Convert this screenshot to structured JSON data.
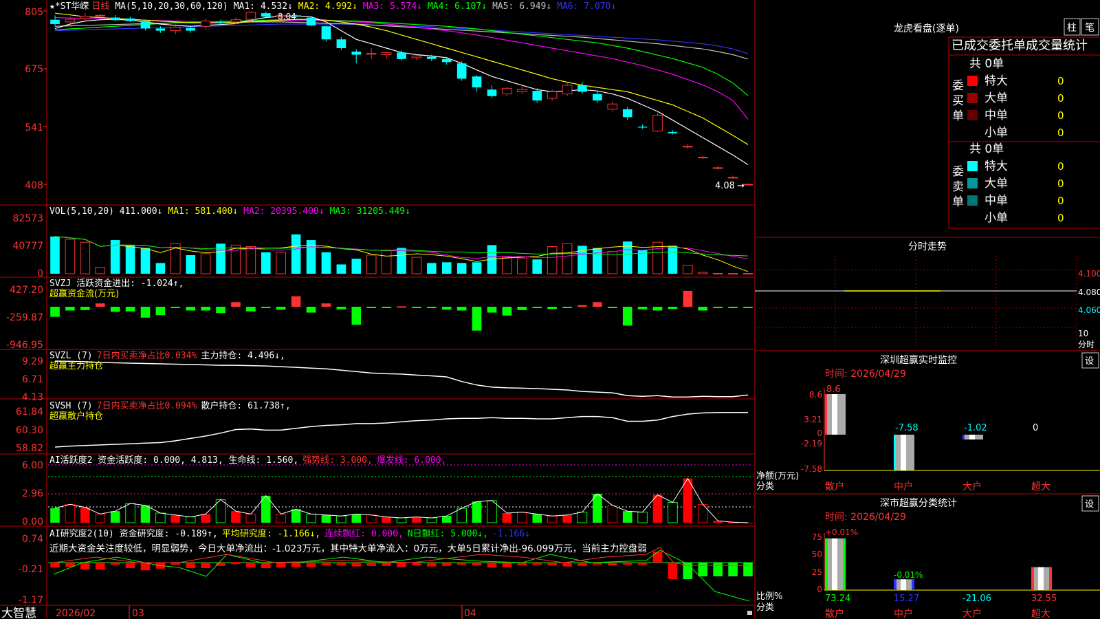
{
  "stock": {
    "name": "★*ST华嵘",
    "period": "日线",
    "ma_header": {
      "label": "MA(5,10,20,30,60,120)",
      "items": [
        {
          "text": "MA1: 4.532↓",
          "color": "#ffffff"
        },
        {
          "text": "MA2: 4.992↓",
          "color": "#ffff00"
        },
        {
          "text": "MA3: 5.574↓",
          "color": "#ff00ff"
        },
        {
          "text": "MA4: 6.107↓",
          "color": "#00ff00"
        },
        {
          "text": "MA5: 6.949↓",
          "color": "#c0c0c0"
        },
        {
          "text": "MA6: 7.070↓",
          "color": "#3333ff"
        }
      ]
    },
    "price_axis": [
      "805",
      "675",
      "541",
      "408"
    ],
    "high_label": "8.04",
    "last_label": "4.08"
  },
  "vol_panel": {
    "header": "VOL(5,10,20) 411.000↓",
    "items": [
      {
        "text": "MA1: 581.400↓",
        "color": "#ffff00"
      },
      {
        "text": "MA2: 20395.400↓",
        "color": "#ff00ff"
      },
      {
        "text": "MA3: 31205.449↓",
        "color": "#00ff00"
      }
    ],
    "axis": [
      "82573",
      "40777",
      "0"
    ]
  },
  "svzj_panel": {
    "header": "SVZJ  活跃资金进出: -1.024↑,",
    "subtitle": "超赢资金流(万元)",
    "axis": [
      "427.20",
      "-259.87",
      "-946.95"
    ]
  },
  "svzl_panel": {
    "title": "SVZL (7)",
    "red_text": "7日内买卖净占比0.034%",
    "tail": "主力持仓: 4.496↓,",
    "subtitle": "超赢主力持仓",
    "axis": [
      "9.29",
      "6.71",
      "4.13"
    ]
  },
  "svsh_panel": {
    "title": "SVSH (7)",
    "red_text": "7日内买卖净占比0.094%",
    "tail": "散户持仓: 61.738↑,",
    "subtitle": "超赢散户持仓",
    "axis": [
      "61.84",
      "60.30",
      "58.82"
    ]
  },
  "ai_active_panel": {
    "header": "AI活跃度2 资金活跃度: 0.000, 4.813, 生命线: 1.560,",
    "strong": "强势线: 3.000,",
    "burst": "爆发线: 6.000,",
    "axis": [
      "6.00",
      "2.96",
      "0.00"
    ]
  },
  "ai_research_panel": {
    "header": "AI研究度2(10) 资金研究度: -0.189↑,",
    "avg": "平均研究度: -1.166↓,",
    "lianxu": "连续飘红: 0.000,",
    "nday": "N日飘红: 5.000↓,",
    "last": "-1.166↓",
    "comment": "近期大资金关注度较低，明显弱势，今日大单净流出：-1.023万元，其中特大单净流入：0万元，大单5日累计净出-96.099万元，当前主力控盘弱",
    "axis": [
      "0.74",
      "-0.21",
      "-1.17"
    ]
  },
  "date_axis": {
    "logo": "大智慧",
    "labels": [
      "2026/02",
      "03",
      "04"
    ]
  },
  "dragon_tiger": {
    "title": "龙虎看盘(逐单)",
    "btn_bar": "柱",
    "btn_pen": "笔",
    "tabs": "已成交委托单成交量统计",
    "buy": {
      "side": "委买单",
      "total": "共 0单",
      "rows": [
        {
          "label": "特大",
          "value": "0",
          "color": "#ff0000"
        },
        {
          "label": "大单",
          "value": "0",
          "color": "#990000"
        },
        {
          "label": "中单",
          "value": "0",
          "color": "#660000"
        },
        {
          "label": "小单",
          "value": "0",
          "color": ""
        }
      ]
    },
    "sell": {
      "side": "委卖单",
      "total": "共 0单",
      "rows": [
        {
          "label": "特大",
          "value": "0",
          "color": "#00ffff"
        },
        {
          "label": "大单",
          "value": "0",
          "color": "#009999"
        },
        {
          "label": "中单",
          "value": "0",
          "color": "#007777"
        },
        {
          "label": "小单",
          "value": "0",
          "color": ""
        }
      ]
    }
  },
  "intraday": {
    "title": "分时走势",
    "axis": [
      "4.100",
      "4.080",
      "4.060"
    ],
    "unit_top": "10",
    "unit_bottom": "分时"
  },
  "sz_monitor": {
    "title": "深圳超赢实时监控",
    "settings": "设",
    "time": "时间: 2026/04/29",
    "axis": [
      "8.6",
      "3.21",
      "0",
      "-2.19",
      "-7.58"
    ],
    "ylabel": "净额(万元)",
    "xlabel": "分类",
    "categories": [
      "散户",
      "中户",
      "大户",
      "超大"
    ],
    "values": [
      8.6,
      -7.58,
      -1.02,
      0
    ],
    "value_labels": [
      "8.6",
      "-7.58",
      "-1.02",
      "0"
    ]
  },
  "sz_class": {
    "title": "深市超赢分类统计",
    "settings": "设",
    "time": "时间: 2026/04/29",
    "axis": [
      "75",
      "50",
      "25",
      "0"
    ],
    "ylabel": "比例%",
    "xlabel": "分类",
    "categories": [
      "散户",
      "中户",
      "大户",
      "超大"
    ],
    "values": [
      73.24,
      15.27,
      -21.06,
      32.55
    ],
    "value_labels": [
      "73.24",
      "15.27",
      "-21.06",
      "32.55"
    ],
    "change_labels": [
      "+0.01%",
      "-0.01%",
      "",
      ""
    ]
  },
  "chart_data": {
    "type": "candlestick",
    "title": "★*ST华嵘 日线",
    "x_labels": [
      "2026/02",
      "03",
      "04"
    ],
    "ohlc": [
      [
        7.85,
        7.95,
        7.7,
        7.75
      ],
      [
        7.8,
        7.92,
        7.72,
        7.86
      ],
      [
        7.88,
        8.0,
        7.8,
        7.93
      ],
      [
        7.95,
        7.98,
        7.9,
        7.95
      ],
      [
        7.9,
        7.96,
        7.82,
        7.84
      ],
      [
        7.88,
        7.92,
        7.8,
        7.82
      ],
      [
        7.82,
        7.85,
        7.6,
        7.65
      ],
      [
        7.65,
        7.7,
        7.55,
        7.6
      ],
      [
        7.6,
        7.75,
        7.52,
        7.68
      ],
      [
        7.66,
        7.7,
        7.55,
        7.6
      ],
      [
        7.7,
        7.88,
        7.62,
        7.82
      ],
      [
        7.8,
        7.85,
        7.72,
        7.78
      ],
      [
        7.8,
        7.9,
        7.75,
        7.85
      ],
      [
        7.86,
        8.04,
        7.82,
        8.02
      ],
      [
        8.0,
        8.04,
        7.9,
        7.92
      ],
      [
        7.92,
        7.98,
        7.85,
        7.95
      ],
      [
        7.95,
        7.98,
        7.9,
        7.92
      ],
      [
        7.9,
        7.92,
        7.7,
        7.72
      ],
      [
        7.7,
        7.72,
        7.35,
        7.4
      ],
      [
        7.4,
        7.45,
        7.15,
        7.2
      ],
      [
        7.12,
        7.18,
        6.85,
        7.05
      ],
      [
        7.06,
        7.2,
        6.95,
        7.08
      ],
      [
        7.05,
        7.12,
        6.95,
        7.1
      ],
      [
        7.1,
        7.15,
        6.92,
        6.95
      ],
      [
        6.98,
        7.05,
        6.92,
        7.02
      ],
      [
        7.0,
        7.05,
        6.9,
        6.95
      ],
      [
        6.95,
        6.98,
        6.82,
        6.88
      ],
      [
        6.85,
        6.9,
        6.45,
        6.5
      ],
      [
        6.55,
        6.58,
        6.2,
        6.3
      ],
      [
        6.25,
        6.35,
        6.05,
        6.1
      ],
      [
        6.15,
        6.3,
        6.1,
        6.28
      ],
      [
        6.2,
        6.35,
        6.15,
        6.25
      ],
      [
        6.22,
        6.28,
        5.95,
        6.0
      ],
      [
        6.05,
        6.25,
        6.0,
        6.2
      ],
      [
        6.15,
        6.4,
        6.1,
        6.35
      ],
      [
        6.35,
        6.42,
        6.15,
        6.2
      ],
      [
        6.15,
        6.22,
        5.95,
        6.0
      ],
      [
        5.8,
        5.98,
        5.75,
        5.92
      ],
      [
        5.8,
        5.85,
        5.55,
        5.62
      ],
      [
        5.4,
        5.45,
        5.35,
        5.38
      ],
      [
        5.3,
        5.72,
        5.28,
        5.66
      ],
      [
        5.28,
        5.32,
        5.22,
        5.25
      ],
      [
        4.95,
        5.0,
        4.9,
        4.95
      ],
      [
        4.7,
        4.74,
        4.66,
        4.7
      ],
      [
        4.46,
        4.5,
        4.42,
        4.46
      ],
      [
        4.24,
        4.28,
        4.2,
        4.24
      ],
      [
        4.08,
        4.1,
        4.06,
        4.08
      ]
    ],
    "ma": {
      "MA1": [
        7.65,
        7.75,
        7.82,
        7.85,
        7.86,
        7.84,
        7.8,
        7.75,
        7.72,
        7.7,
        7.72,
        7.74,
        7.76,
        7.84,
        7.9,
        7.93,
        7.94,
        7.92,
        7.8,
        7.6,
        7.4,
        7.3,
        7.2,
        7.1,
        7.05,
        7.02,
        6.98,
        6.85,
        6.7,
        6.55,
        6.45,
        6.35,
        6.25,
        6.2,
        6.22,
        6.25,
        6.22,
        6.15,
        6.05,
        5.9,
        5.75,
        5.55,
        5.35,
        5.15,
        4.95,
        4.75,
        4.53
      ],
      "MA2": [
        8.0,
        7.96,
        7.92,
        7.9,
        7.88,
        7.86,
        7.84,
        7.82,
        7.8,
        7.78,
        7.78,
        7.78,
        7.79,
        7.8,
        7.82,
        7.84,
        7.86,
        7.86,
        7.84,
        7.8,
        7.75,
        7.68,
        7.6,
        7.5,
        7.4,
        7.3,
        7.2,
        7.1,
        7.0,
        6.9,
        6.8,
        6.7,
        6.6,
        6.5,
        6.42,
        6.35,
        6.3,
        6.25,
        6.2,
        6.1,
        6.0,
        5.9,
        5.75,
        5.6,
        5.4,
        5.2,
        4.99
      ],
      "MA3": [
        7.9,
        7.89,
        7.88,
        7.87,
        7.86,
        7.85,
        7.84,
        7.83,
        7.82,
        7.81,
        7.8,
        7.8,
        7.8,
        7.81,
        7.82,
        7.83,
        7.84,
        7.84,
        7.83,
        7.82,
        7.8,
        7.78,
        7.75,
        7.72,
        7.68,
        7.64,
        7.6,
        7.55,
        7.5,
        7.44,
        7.38,
        7.32,
        7.26,
        7.2,
        7.14,
        7.08,
        7.02,
        6.96,
        6.88,
        6.8,
        6.7,
        6.6,
        6.48,
        6.36,
        6.2,
        6.0,
        5.57
      ],
      "MA4": [
        7.62,
        7.64,
        7.66,
        7.68,
        7.7,
        7.72,
        7.74,
        7.76,
        7.78,
        7.79,
        7.8,
        7.81,
        7.82,
        7.83,
        7.84,
        7.85,
        7.85,
        7.85,
        7.84,
        7.83,
        7.82,
        7.8,
        7.78,
        7.76,
        7.74,
        7.72,
        7.7,
        7.67,
        7.64,
        7.6,
        7.56,
        7.52,
        7.48,
        7.44,
        7.4,
        7.36,
        7.32,
        7.26,
        7.2,
        7.12,
        7.04,
        6.96,
        6.86,
        6.76,
        6.6,
        6.4,
        6.11
      ],
      "MA5": [
        7.7,
        7.71,
        7.72,
        7.73,
        7.74,
        7.75,
        7.76,
        7.77,
        7.78,
        7.79,
        7.8,
        7.8,
        7.8,
        7.8,
        7.8,
        7.8,
        7.79,
        7.78,
        7.77,
        7.76,
        7.75,
        7.73,
        7.71,
        7.69,
        7.67,
        7.65,
        7.63,
        7.61,
        7.59,
        7.57,
        7.55,
        7.53,
        7.51,
        7.49,
        7.47,
        7.45,
        7.42,
        7.39,
        7.36,
        7.33,
        7.3,
        7.26,
        7.22,
        7.18,
        7.12,
        7.05,
        6.95
      ],
      "MA6": [
        7.6,
        7.61,
        7.62,
        7.63,
        7.64,
        7.65,
        7.66,
        7.67,
        7.68,
        7.69,
        7.7,
        7.71,
        7.72,
        7.73,
        7.74,
        7.75,
        7.75,
        7.75,
        7.75,
        7.75,
        7.74,
        7.73,
        7.72,
        7.71,
        7.7,
        7.69,
        7.67,
        7.65,
        7.63,
        7.61,
        7.59,
        7.57,
        7.55,
        7.53,
        7.51,
        7.49,
        7.47,
        7.45,
        7.43,
        7.41,
        7.39,
        7.36,
        7.33,
        7.3,
        7.25,
        7.18,
        7.07
      ]
    },
    "volume": [
      52000,
      48000,
      44000,
      9000,
      47000,
      40000,
      36000,
      15000,
      42000,
      26000,
      28000,
      42000,
      40000,
      38000,
      30000,
      30000,
      55000,
      47000,
      30000,
      13000,
      21000,
      26000,
      33000,
      36000,
      23000,
      15000,
      16000,
      15000,
      16000,
      40000,
      23000,
      22000,
      20000,
      38000,
      42000,
      39000,
      36000,
      31000,
      45000,
      33000,
      44000,
      39000,
      12000,
      2000,
      500,
      400,
      411
    ],
    "fund_flow": [
      -240,
      -90,
      -80,
      80,
      -120,
      -110,
      -260,
      -200,
      -20,
      -90,
      -90,
      -150,
      110,
      -110,
      -30,
      -70,
      250,
      -140,
      80,
      -60,
      -430,
      -20,
      -25,
      10,
      -30,
      -20,
      -70,
      -90,
      -570,
      -140,
      -210,
      -80,
      -30,
      -50,
      -30,
      40,
      110,
      -30,
      -450,
      -60,
      -90,
      -50,
      380,
      -90,
      -20,
      -20,
      -10
    ],
    "main_hold": [
      9.29,
      9.25,
      9.2,
      9.1,
      9.05,
      9.0,
      8.95,
      8.9,
      8.85,
      8.8,
      8.75,
      8.7,
      8.7,
      8.65,
      8.6,
      8.5,
      8.4,
      8.3,
      8.2,
      8.0,
      7.8,
      7.6,
      7.5,
      7.45,
      7.3,
      7.2,
      7.05,
      6.4,
      5.9,
      5.6,
      5.5,
      5.45,
      5.4,
      5.3,
      5.2,
      5.0,
      4.9,
      4.8,
      4.4,
      4.3,
      4.4,
      4.2,
      4.2,
      4.3,
      4.25,
      4.25,
      4.5
    ],
    "retail_hold": [
      58.82,
      58.9,
      58.95,
      59.0,
      59.05,
      59.1,
      59.15,
      59.2,
      59.35,
      59.55,
      59.75,
      60.0,
      60.3,
      60.35,
      60.25,
      60.25,
      60.4,
      60.55,
      60.65,
      60.7,
      60.8,
      60.8,
      60.85,
      60.95,
      61.05,
      61.1,
      61.2,
      61.25,
      61.25,
      61.3,
      61.25,
      61.25,
      61.2,
      61.2,
      61.3,
      61.4,
      61.4,
      61.3,
      61.0,
      61.0,
      61.1,
      61.4,
      61.6,
      61.7,
      61.74,
      61.74,
      61.74
    ],
    "activity": [
      1.5,
      1.9,
      1.6,
      0.9,
      1.2,
      2.0,
      1.8,
      1.0,
      0.8,
      0.6,
      0.9,
      2.4,
      1.2,
      0.9,
      2.8,
      0.9,
      1.4,
      0.9,
      0.8,
      0.7,
      0.9,
      0.8,
      0.6,
      0.5,
      0.6,
      0.5,
      0.7,
      1.5,
      2.2,
      2.3,
      1.0,
      1.1,
      0.9,
      0.7,
      0.8,
      1.1,
      3.0,
      1.8,
      1.2,
      1.1,
      2.9,
      2.1,
      4.6,
      1.9,
      0.2,
      0.05,
      0.0
    ],
    "research": [
      -0.18,
      -0.15,
      -0.25,
      -0.25,
      -0.08,
      -0.2,
      -0.28,
      -0.22,
      -0.05,
      -0.2,
      -0.2,
      -0.12,
      0.02,
      -0.18,
      -0.2,
      -0.18,
      -0.16,
      -0.16,
      -0.1,
      -0.1,
      -0.14,
      -0.12,
      -0.12,
      -0.16,
      -0.1,
      -0.14,
      -0.12,
      -0.08,
      -0.1,
      -0.18,
      -0.16,
      -0.1,
      -0.08,
      -0.1,
      -0.14,
      -0.12,
      -0.04,
      -0.1,
      -0.08,
      -0.08,
      0.4,
      -0.6,
      -0.6,
      -0.5,
      -0.5,
      -0.5,
      -0.5
    ]
  }
}
